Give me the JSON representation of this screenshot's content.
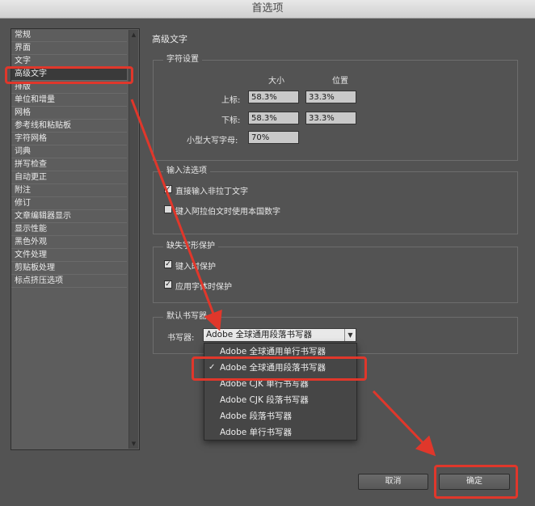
{
  "window": {
    "title": "首选项"
  },
  "sidebar": {
    "items": [
      {
        "label": "常规"
      },
      {
        "label": "界面"
      },
      {
        "label": "文字"
      },
      {
        "label": "高级文字"
      },
      {
        "label": "排版"
      },
      {
        "label": "单位和增量"
      },
      {
        "label": "网格"
      },
      {
        "label": "参考线和粘贴板"
      },
      {
        "label": "字符网格"
      },
      {
        "label": "词典"
      },
      {
        "label": "拼写检查"
      },
      {
        "label": "自动更正"
      },
      {
        "label": "附注"
      },
      {
        "label": "修订"
      },
      {
        "label": "文章编辑器显示"
      },
      {
        "label": "显示性能"
      },
      {
        "label": "黑色外观"
      },
      {
        "label": "文件处理"
      },
      {
        "label": "剪贴板处理"
      },
      {
        "label": "标点挤压选项"
      }
    ],
    "selected_index": 3
  },
  "panel": {
    "title": "高级文字",
    "char_settings": {
      "title": "字符设置",
      "col_size": "大小",
      "col_position": "位置",
      "superscript_label": "上标:",
      "superscript_size": "58.3%",
      "superscript_position": "33.3%",
      "subscript_label": "下标:",
      "subscript_size": "58.3%",
      "subscript_position": "33.3%",
      "small_caps_label": "小型大写字母:",
      "small_caps_value": "70%"
    },
    "input_method": {
      "title": "输入法选项",
      "direct_input_label": "直接输入非拉丁文字",
      "direct_input_checked": true,
      "arabic_digits_label": "键入阿拉伯文时使用本国数字",
      "arabic_digits_checked": false
    },
    "missing_glyph": {
      "title": "缺失字形保护",
      "on_typing_label": "键入时保护",
      "on_typing_checked": true,
      "on_font_label": "应用字体时保护",
      "on_font_checked": true
    },
    "default_composer": {
      "title": "默认书写器",
      "composer_label": "书写器:",
      "composer_value": "Adobe 全球通用段落书写器",
      "options": [
        {
          "label": "Adobe 全球通用单行书写器",
          "checked": false
        },
        {
          "label": "Adobe 全球通用段落书写器",
          "checked": true
        },
        {
          "label": "Adobe CJK 单行书写器",
          "checked": false
        },
        {
          "label": "Adobe CJK 段落书写器",
          "checked": false
        },
        {
          "label": "Adobe 段落书写器",
          "checked": false
        },
        {
          "label": "Adobe 单行书写器",
          "checked": false
        }
      ]
    }
  },
  "buttons": {
    "cancel": "取消",
    "ok": "确定"
  },
  "colors": {
    "highlight": "#e0372b",
    "background": "#535353"
  }
}
